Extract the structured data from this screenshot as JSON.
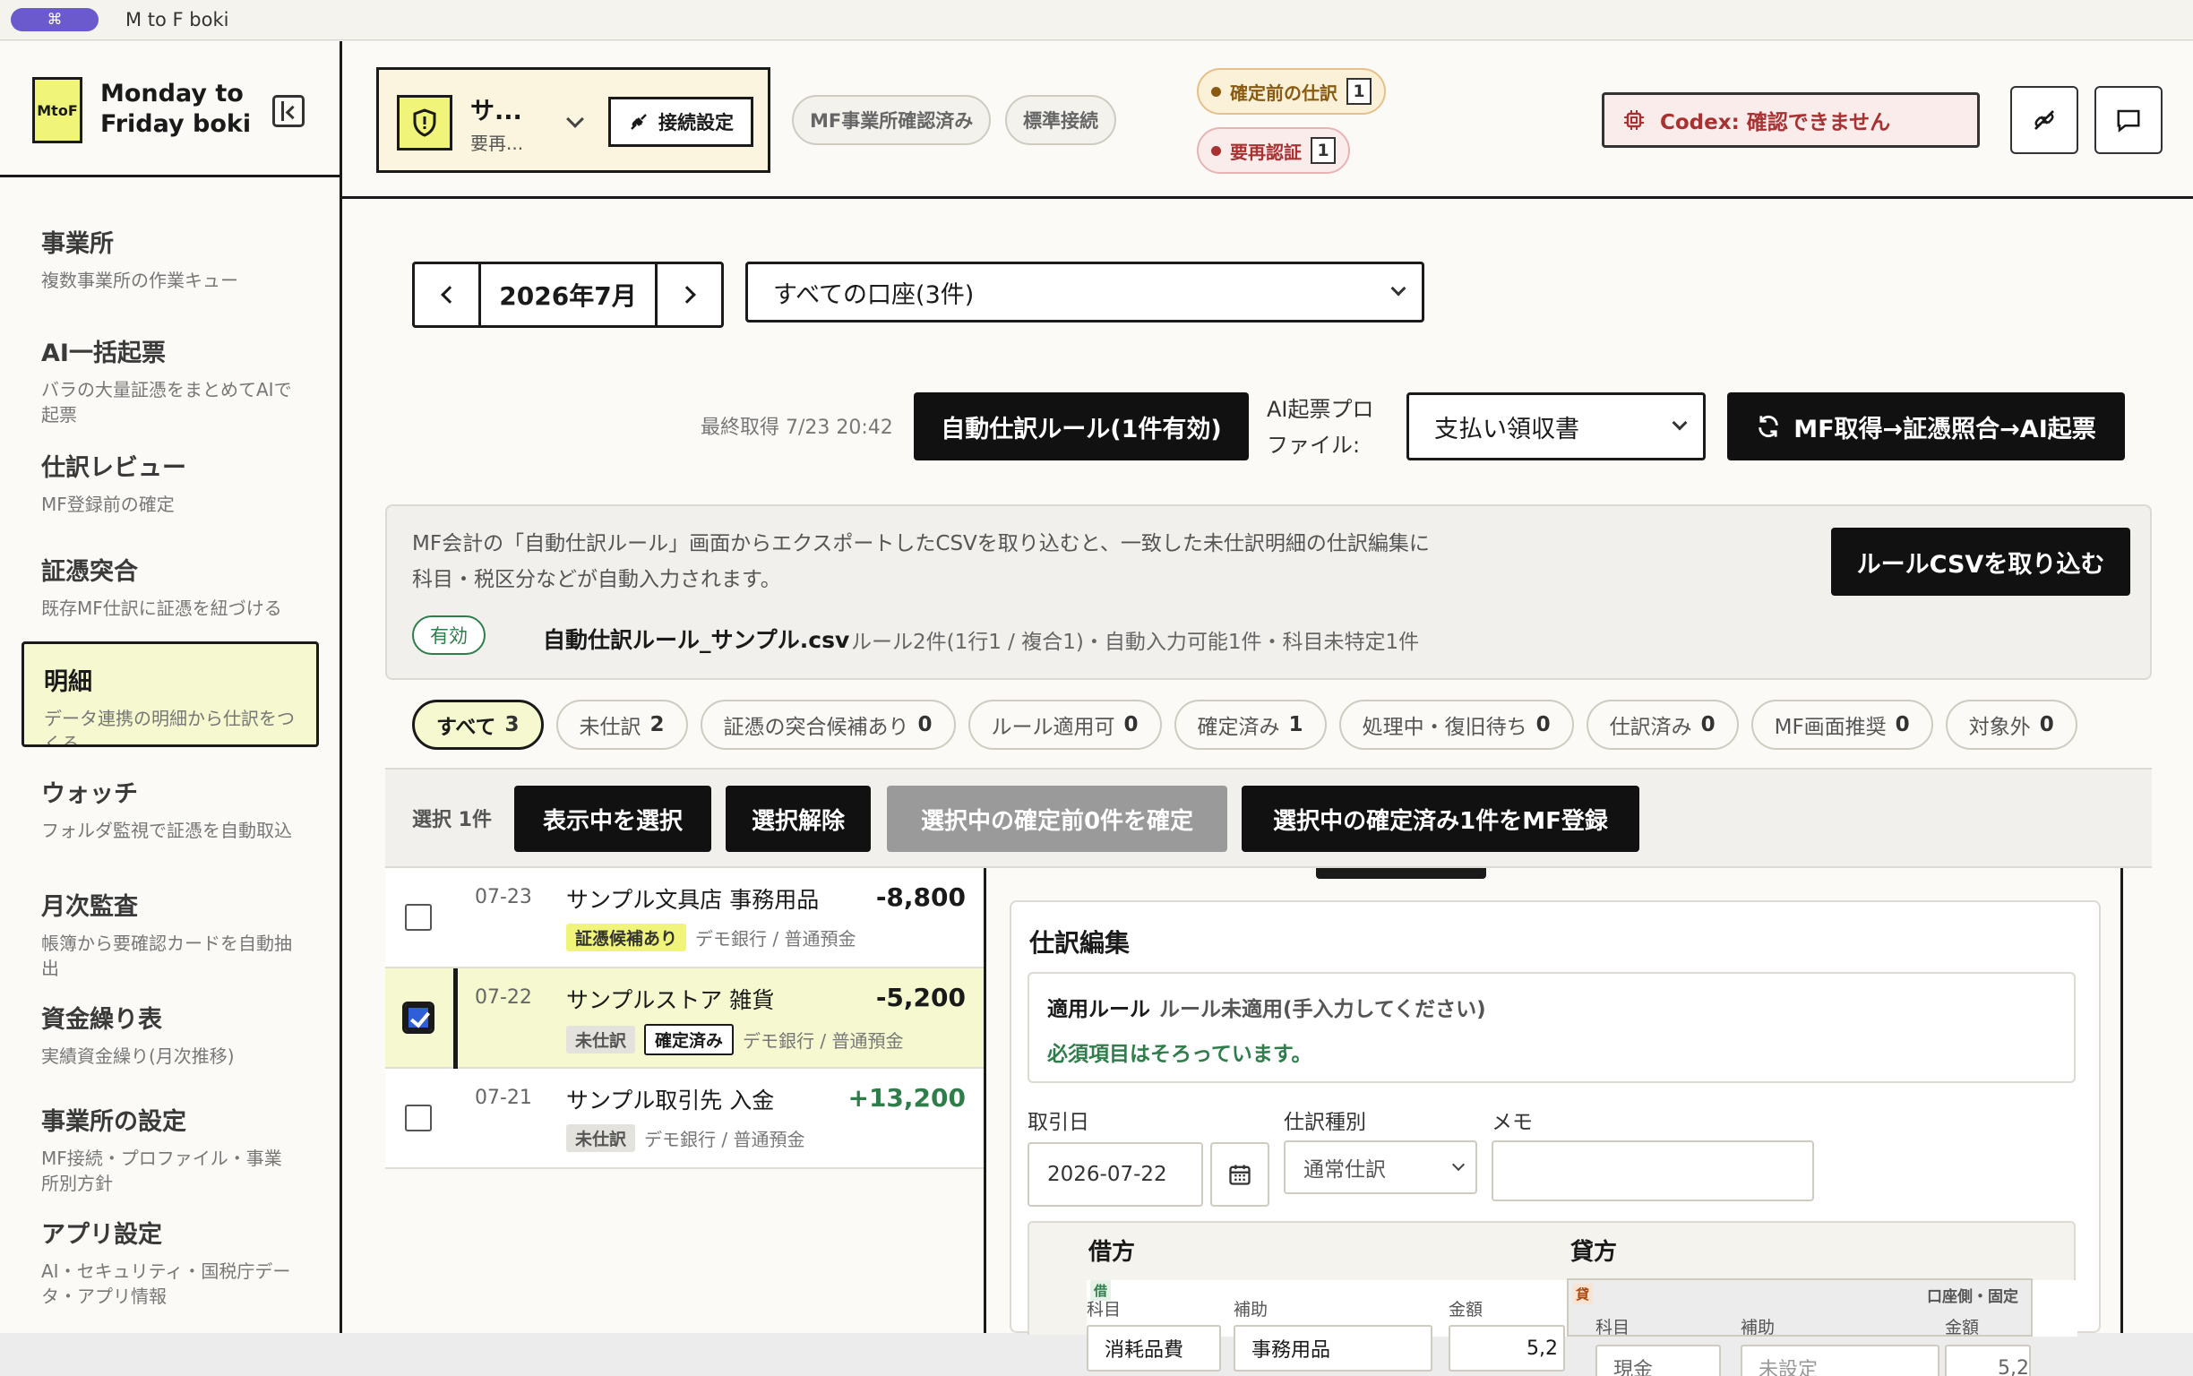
{
  "window": {
    "title": "M to F boki",
    "pill_icon": "⌘"
  },
  "brand": {
    "logo": "MtoF",
    "name": "Monday to Friday boki"
  },
  "sidebar": {
    "items": [
      {
        "label": "事業所",
        "desc": "複数事業所の作業キュー"
      },
      {
        "label": "AI一括起票",
        "desc": "バラの大量証憑をまとめてAIで起票"
      },
      {
        "label": "仕訳レビュー",
        "desc": "MF登録前の確定"
      },
      {
        "label": "証憑突合",
        "desc": "既存MF仕訳に証憑を紐づける"
      },
      {
        "label": "明細",
        "desc": "データ連携の明細から仕訳をつくる"
      },
      {
        "label": "ウォッチ",
        "desc": "フォルダ監視で証憑を自動取込"
      },
      {
        "label": "月次監査",
        "desc": "帳簿から要確認カードを自動抽出"
      },
      {
        "label": "資金繰り表",
        "desc": "実績資金繰り(月次推移)"
      },
      {
        "label": "事業所の設定",
        "desc": "MF接続・プロファイル・事業所別方針"
      },
      {
        "label": "アプリ設定",
        "desc": "AI・セキュリティ・国税庁データ・アプリ情報"
      }
    ],
    "active_index": 4
  },
  "header": {
    "office_name": "サ...",
    "office_sub": "要再...",
    "connect_btn": "接続設定",
    "chip_verified": "MF事業所確認済み",
    "chip_standard": "標準接続",
    "pending_label": "確定前の仕訳",
    "pending_count": "1",
    "reauth_label": "要再認証",
    "reauth_count": "1",
    "codex_status": "Codex: 確認できません"
  },
  "toolbar": {
    "month": "2026年7月",
    "account_select": "すべての口座(3件)",
    "last_fetch": "最終取得 7/23 20:42",
    "auto_rule_btn": "自動仕訳ルール(1件有効)",
    "profile_label": "AI起票プロファイル:",
    "profile_value": "支払い領収書",
    "run_btn": "MF取得→証憑照合→AI起票"
  },
  "info": {
    "text": "MF会計の「自動仕訳ルール」画面からエクスポートしたCSVを取り込むと、一致した未仕訳明細の仕訳編集に科目・税区分などが自動入力されます。",
    "import_btn": "ルールCSVを取り込む",
    "status": "有効",
    "csv_name": "自動仕訳ルール_サンプル.csv",
    "csv_meta": "ルール2件(1行1 / 複合1)・自動入力可能1件・科目未特定1件"
  },
  "filters": [
    {
      "label": "すべて",
      "count": "3"
    },
    {
      "label": "未仕訳",
      "count": "2"
    },
    {
      "label": "証憑の突合候補あり",
      "count": "0"
    },
    {
      "label": "ルール適用可",
      "count": "0"
    },
    {
      "label": "確定済み",
      "count": "1"
    },
    {
      "label": "処理中・復旧待ち",
      "count": "0"
    },
    {
      "label": "仕訳済み",
      "count": "0"
    },
    {
      "label": "MF画面推奨",
      "count": "0"
    },
    {
      "label": "対象外",
      "count": "0"
    }
  ],
  "actions": {
    "selected": "選択 1件",
    "select_visible": "表示中を選択",
    "deselect": "選択解除",
    "confirm_pending": "選択中の確定前0件を確定",
    "register": "選択中の確定済み1件をMF登録"
  },
  "rows": [
    {
      "date": "07-23",
      "name": "サンプル文具店 事務用品",
      "amount": "-8,800",
      "tags": [
        "証憑候補あり"
      ],
      "account": "デモ銀行 / 普通預金",
      "checked": false
    },
    {
      "date": "07-22",
      "name": "サンプルストア 雑貨",
      "amount": "-5,200",
      "tags": [
        "未仕訳",
        "確定済み"
      ],
      "account": "デモ銀行 / 普通預金",
      "checked": true
    },
    {
      "date": "07-21",
      "name": "サンプル取引先 入金",
      "amount": "+13,200",
      "tags": [
        "未仕訳"
      ],
      "account": "デモ銀行 / 普通預金",
      "checked": false
    }
  ],
  "editor": {
    "title": "仕訳編集",
    "rule_label": "適用ルール",
    "rule_value": "ルール未適用(手入力してください)",
    "rule_ok": "必須項目はそろっています。",
    "date_label": "取引日",
    "date_value": "2026-07-22",
    "type_label": "仕訳種別",
    "type_value": "通常仕訳",
    "memo_label": "メモ",
    "debit_head": "借方",
    "credit_head": "貸方",
    "debit_badge": "借",
    "credit_badge": "貸",
    "credit_fixed": "口座側・固定",
    "col_account": "科目",
    "col_sub": "補助",
    "col_amount": "金額",
    "debit_account": "消耗品費",
    "debit_sub": "事務用品",
    "debit_amount": "5,2",
    "credit_account": "現金",
    "credit_sub": "未設定",
    "credit_amount": "5,2"
  },
  "colors": {
    "accent_yellow": "#f0f57a",
    "dark": "#111111",
    "positive": "#2f7d4a",
    "warning": "#a83232"
  }
}
